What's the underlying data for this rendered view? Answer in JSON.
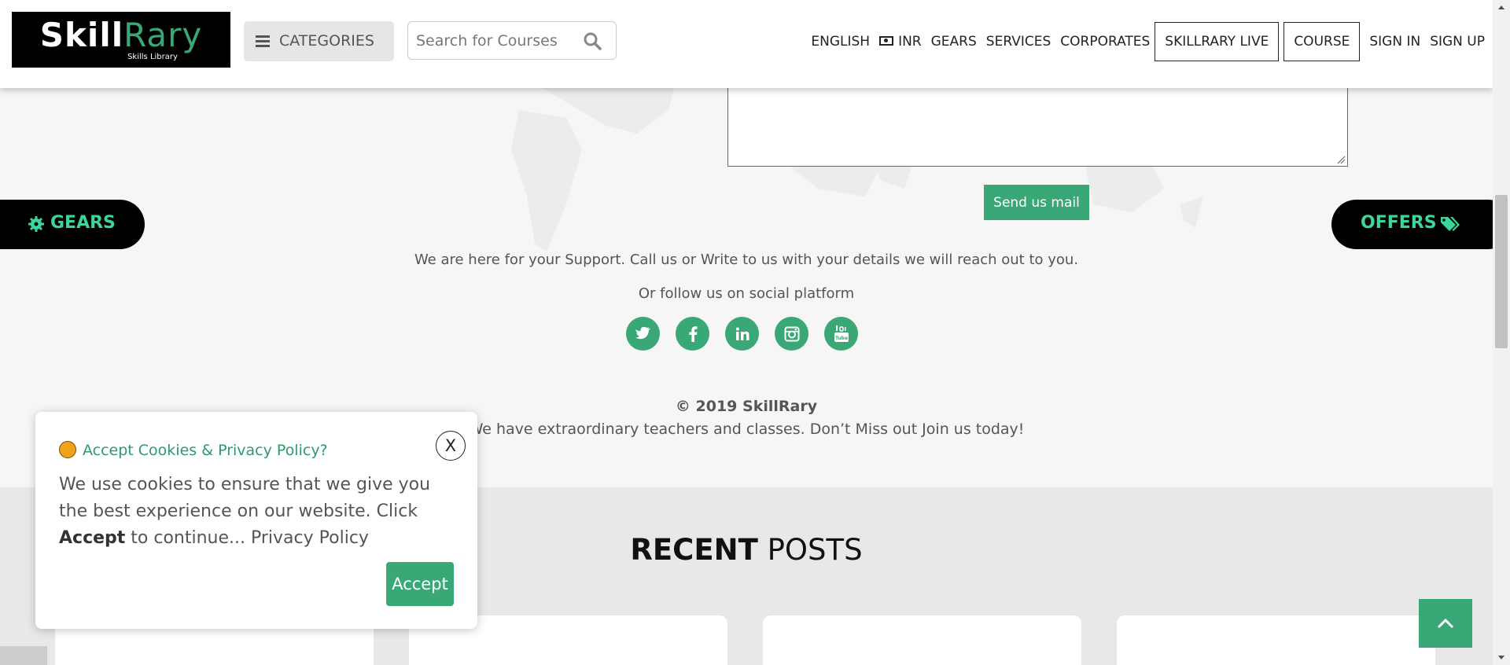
{
  "header": {
    "logo": {
      "primary": "Skill",
      "secondary": "Rary",
      "subtitle": "Skills Library"
    },
    "categories_label": "CATEGORIES",
    "search_placeholder": "Search for Courses",
    "nav": {
      "english": "ENGLISH",
      "inr": "INR",
      "gears": "GEARS",
      "services": "SERVICES",
      "corporates": "CORPORATES",
      "skillrary_live": "SKILLRARY LIVE",
      "course": "COURSE",
      "sign_in": "SIGN IN",
      "sign_up": "SIGN UP"
    }
  },
  "contact": {
    "send_label": "Send us mail",
    "support_text": "We are here for your Support. Call us or Write to us with your details we will reach out to you.",
    "follow_text": "Or follow us on social platform",
    "social": [
      "twitter-icon",
      "facebook-icon",
      "linkedin-icon",
      "instagram-icon",
      "youtube-icon"
    ]
  },
  "footer": {
    "copyright": "© 2019 SkillRary",
    "tagline": "We have extraordinary teachers and classes. Don’t Miss out Join us today!"
  },
  "side": {
    "gears": "GEARS",
    "offers": "OFFERS"
  },
  "recent": {
    "bold": "RECENT",
    "rest": "POSTS"
  },
  "cookie": {
    "title": "Accept Cookies & Privacy Policy?",
    "close": "X",
    "text_start": "We use cookies to ensure that we give you the best experience on our website. Click ",
    "text_bold": "Accept",
    "text_end": " to continue... Privacy Policy",
    "accept": "Accept"
  },
  "colors": {
    "brand_green": "#3aa876",
    "pill_text": "#3ad69a",
    "error_border": "#e32"
  }
}
